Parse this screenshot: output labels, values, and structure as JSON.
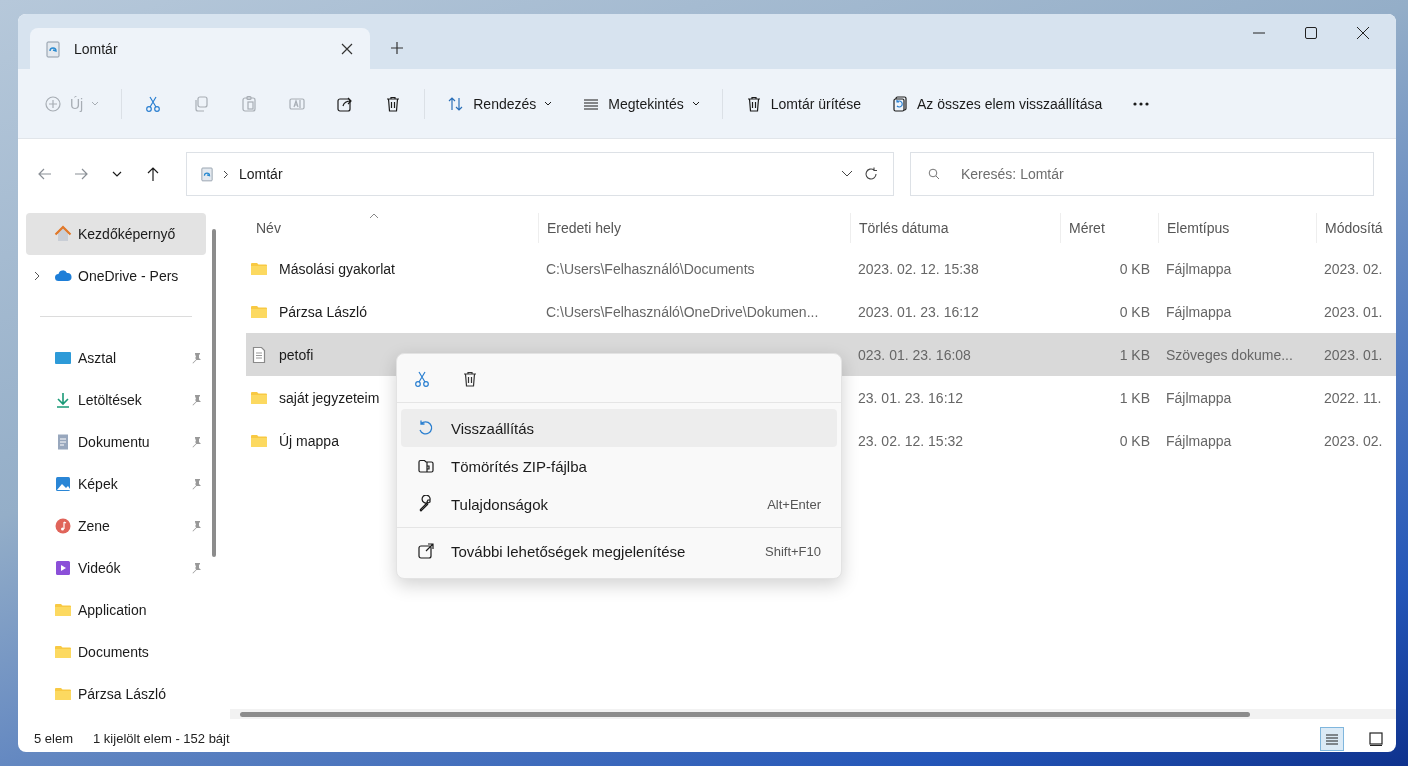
{
  "tab": {
    "title": "Lomtár",
    "selected": true
  },
  "toolbar": {
    "groups": [
      [
        {
          "kind": "new",
          "label": "Új",
          "disabled": true,
          "dropdown": true
        }
      ],
      [
        {
          "kind": "cut",
          "disabled": false,
          "dropdown": false
        },
        {
          "kind": "copy",
          "disabled": true,
          "dropdown": false
        },
        {
          "kind": "paste",
          "disabled": true,
          "dropdown": false
        },
        {
          "kind": "rename",
          "disabled": true,
          "dropdown": false
        },
        {
          "kind": "share",
          "disabled": false,
          "dropdown": false
        },
        {
          "kind": "delete",
          "disabled": false,
          "dropdown": false
        }
      ],
      [
        {
          "kind": "sort",
          "label": "Rendezés",
          "disabled": false,
          "dropdown": true
        },
        {
          "kind": "view",
          "label": "Megtekintés",
          "disabled": false,
          "dropdown": true
        }
      ],
      [
        {
          "kind": "empty",
          "label": "Lomtár ürítése",
          "disabled": false,
          "dropdown": false
        },
        {
          "kind": "restore",
          "label": "Az összes elem visszaállítása",
          "disabled": false,
          "dropdown": false
        },
        {
          "kind": "more",
          "disabled": false,
          "dropdown": false
        }
      ]
    ]
  },
  "nav": [
    {
      "kind": "back",
      "disabled": true
    },
    {
      "kind": "forward",
      "disabled": true
    },
    {
      "kind": "recent",
      "disabled": false
    },
    {
      "kind": "up",
      "disabled": false
    }
  ],
  "address": {
    "path": [
      "Lomtár"
    ]
  },
  "search": {
    "placeholder": "Keresés: Lomtár"
  },
  "sidebar": {
    "sections": [
      [
        {
          "kind": "home",
          "label": "Kezdőképernyő",
          "selected": true,
          "pinned": false,
          "expandable": false
        },
        {
          "kind": "cloud",
          "label": "OneDrive - Pers",
          "selected": false,
          "pinned": false,
          "expandable": true
        }
      ],
      [
        {
          "kind": "desktop",
          "label": "Asztal",
          "selected": false,
          "pinned": true,
          "expandable": false
        },
        {
          "kind": "downloads",
          "label": "Letöltések",
          "selected": false,
          "pinned": true,
          "expandable": false
        },
        {
          "kind": "documents",
          "label": "Dokumentu",
          "selected": false,
          "pinned": true,
          "expandable": false
        },
        {
          "kind": "pictures",
          "label": "Képek",
          "selected": false,
          "pinned": true,
          "expandable": false
        },
        {
          "kind": "music",
          "label": "Zene",
          "selected": false,
          "pinned": true,
          "expandable": false
        },
        {
          "kind": "videos",
          "label": "Videók",
          "selected": false,
          "pinned": true,
          "expandable": false
        },
        {
          "kind": "folder",
          "label": "Application",
          "selected": false,
          "pinned": false,
          "expandable": false
        },
        {
          "kind": "folder",
          "label": "Documents",
          "selected": false,
          "pinned": false,
          "expandable": false
        },
        {
          "kind": "folder",
          "label": "Párzsa László",
          "selected": false,
          "pinned": false,
          "expandable": false
        }
      ]
    ]
  },
  "table": {
    "columns": [
      {
        "label": "Név",
        "sorted": true
      },
      {
        "label": "Eredeti hely",
        "sorted": false
      },
      {
        "label": "Törlés dátuma",
        "sorted": false
      },
      {
        "label": "Méret",
        "sorted": false
      },
      {
        "label": "Elemtípus",
        "sorted": false
      },
      {
        "label": "Módosítá",
        "sorted": false
      }
    ],
    "rows": [
      {
        "kind": "folder",
        "name": "Másolási gyakorlat",
        "location": "C:\\Users\\Felhasználó\\Documents",
        "deleted": "2023. 02. 12. 15:38",
        "size": "0 KB",
        "type": "Fájlmappa",
        "modified": "2023. 02.",
        "selected": false
      },
      {
        "kind": "folder",
        "name": "Párzsa László",
        "location": "C:\\Users\\Felhasználó\\OneDrive\\Dokumen...",
        "deleted": "2023. 01. 23. 16:12",
        "size": "0 KB",
        "type": "Fájlmappa",
        "modified": "2023. 01.",
        "selected": false
      },
      {
        "kind": "document",
        "name": "petofi",
        "deleted": "023. 01. 23. 16:08",
        "size": "1 KB",
        "type": "Szöveges dokume...",
        "modified": "2023. 01.",
        "selected": true
      },
      {
        "kind": "folder",
        "name": "saját jegyzeteim",
        "deleted": "23. 01. 23. 16:12",
        "size": "1 KB",
        "type": "Fájlmappa",
        "modified": "2022. 11.",
        "selected": false
      },
      {
        "kind": "folder",
        "name": "Új mappa",
        "deleted": "23. 02. 12. 15:32",
        "size": "0 KB",
        "type": "Fájlmappa",
        "modified": "2023. 02.",
        "selected": false
      }
    ]
  },
  "context_menu": {
    "quick_actions": [
      {
        "kind": "cut"
      },
      {
        "kind": "delete"
      }
    ],
    "sections": [
      [
        {
          "kind": "restore",
          "label": "Visszaállítás",
          "selected": true
        },
        {
          "kind": "zip",
          "label": "Tömörítés ZIP-fájlba",
          "selected": false
        },
        {
          "kind": "properties",
          "label": "Tulajdonságok",
          "shortcut": "Alt+Enter",
          "selected": false
        }
      ],
      [
        {
          "kind": "more_options",
          "label": "További lehetőségek megjelenítése",
          "shortcut": "Shift+F10",
          "selected": false
        }
      ]
    ]
  },
  "status_bar": {
    "count": "5 elem",
    "selection": "1 kijelölt elem - 152 bájt",
    "views": [
      {
        "kind": "details",
        "selected": true
      },
      {
        "kind": "tiles",
        "selected": false
      }
    ]
  }
}
